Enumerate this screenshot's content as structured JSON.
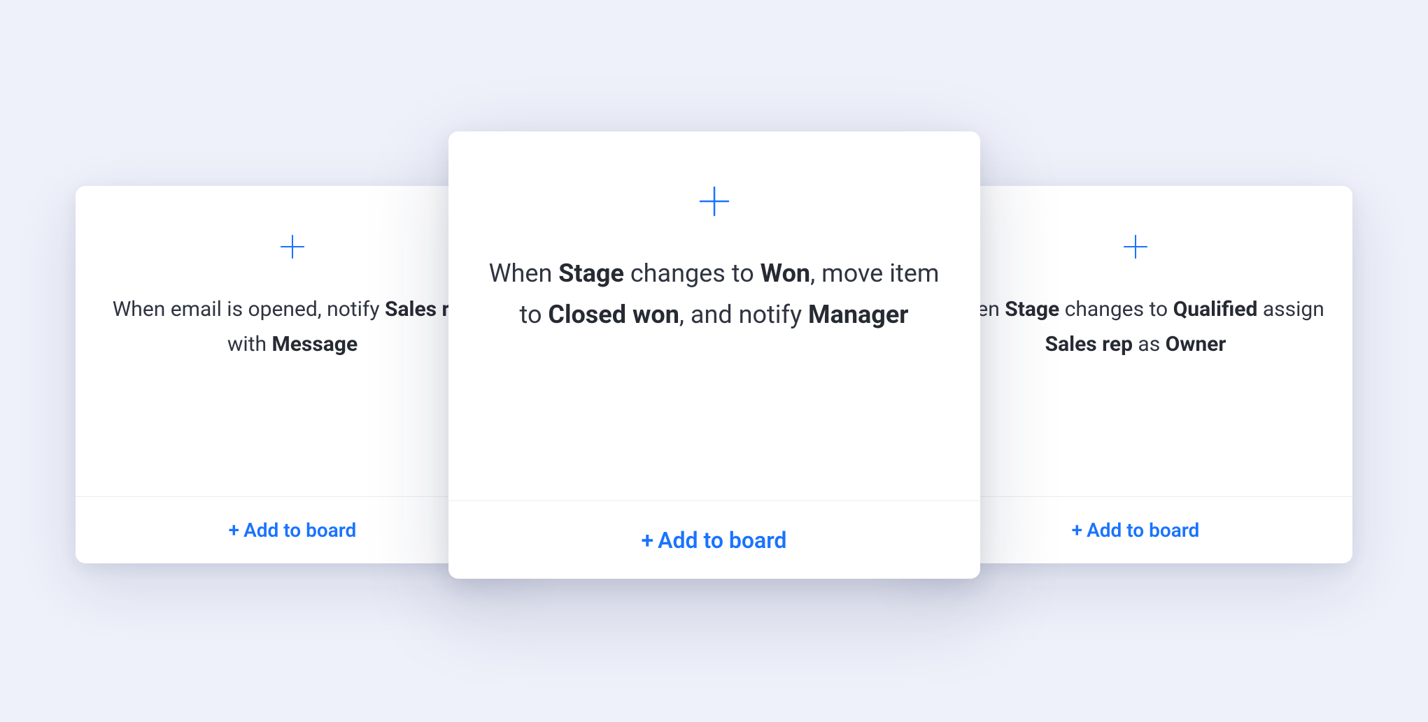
{
  "cards": [
    {
      "segments": [
        {
          "text": "When email is opened, notify ",
          "bold": false
        },
        {
          "text": "Sales rep",
          "bold": true
        },
        {
          "text": " with ",
          "bold": false
        },
        {
          "text": "Message",
          "bold": true
        }
      ],
      "action_label": "Add to board"
    },
    {
      "segments": [
        {
          "text": "When ",
          "bold": false
        },
        {
          "text": "Stage",
          "bold": true
        },
        {
          "text": " changes to ",
          "bold": false
        },
        {
          "text": "Won",
          "bold": true
        },
        {
          "text": ", move item to ",
          "bold": false
        },
        {
          "text": "Closed won",
          "bold": true
        },
        {
          "text": ", and notify ",
          "bold": false
        },
        {
          "text": "Manager",
          "bold": true
        }
      ],
      "action_label": "Add to board"
    },
    {
      "segments": [
        {
          "text": "When ",
          "bold": false
        },
        {
          "text": "Stage",
          "bold": true
        },
        {
          "text": " changes to ",
          "bold": false
        },
        {
          "text": "Qualified",
          "bold": true
        },
        {
          "text": " assign ",
          "bold": false
        },
        {
          "text": "Sales rep",
          "bold": true
        },
        {
          "text": " as ",
          "bold": false
        },
        {
          "text": "Owner",
          "bold": true
        }
      ],
      "action_label": "Add to board"
    }
  ],
  "colors": {
    "accent": "#1a73ff",
    "background": "#eef0fa",
    "card_bg": "#ffffff",
    "text": "#2f3440",
    "divider": "#eceef2"
  }
}
